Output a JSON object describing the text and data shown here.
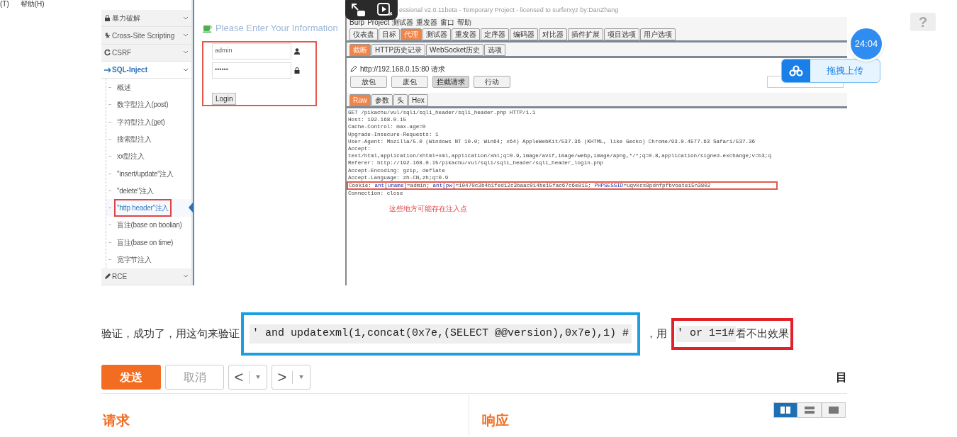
{
  "app_menu": [
    "(T)",
    "帮助(H)"
  ],
  "screenshot": {
    "sidebar": [
      {
        "kind": "group",
        "label": "暴力破解",
        "expanded": false
      },
      {
        "kind": "group",
        "label": "Cross-Site Scripting",
        "expanded": false
      },
      {
        "kind": "group",
        "label": "CSRF",
        "expanded": false
      },
      {
        "kind": "group",
        "label": "SQL-Inject",
        "expanded": true,
        "children": [
          {
            "label": "概述",
            "selected": false,
            "boxed": false
          },
          {
            "label": "数字型注入(post)",
            "selected": false,
            "boxed": false
          },
          {
            "label": "字符型注入(get)",
            "selected": false,
            "boxed": false
          },
          {
            "label": "搜索型注入",
            "selected": false,
            "boxed": false
          },
          {
            "label": "xx型注入",
            "selected": false,
            "boxed": false
          },
          {
            "label": "\"insert/update\"注入",
            "selected": false,
            "boxed": false
          },
          {
            "label": "\"delete\"注入",
            "selected": false,
            "boxed": false
          },
          {
            "label": "\"http header\"注入",
            "selected": true,
            "boxed": true
          },
          {
            "label": "盲注(base on boolian)",
            "selected": false,
            "boxed": false
          },
          {
            "label": "盲注(base on time)",
            "selected": false,
            "boxed": false
          },
          {
            "label": "宽字节注入",
            "selected": false,
            "boxed": false
          }
        ]
      },
      {
        "kind": "group",
        "label": "RCE",
        "expanded": false
      }
    ],
    "login": {
      "title": "Please Enter Your Information",
      "username": "admin",
      "password": "••••••",
      "button": "Login"
    },
    "burp": {
      "title": "essional v2.0.11beta - Temporary Project - licensed to surferxyz by:DanZhang",
      "menu": [
        "Burp",
        "Project",
        "测试器",
        "重发器",
        "窗口",
        "帮助"
      ],
      "tabs": [
        {
          "label": "仪表盘",
          "selected": false
        },
        {
          "label": "目标",
          "selected": false
        },
        {
          "label": "代理",
          "selected": true
        },
        {
          "label": "测试器",
          "selected": false
        },
        {
          "label": "重发器",
          "selected": false
        },
        {
          "label": "定序器",
          "selected": false
        },
        {
          "label": "编码器",
          "selected": false
        },
        {
          "label": "对比器",
          "selected": false
        },
        {
          "label": "插件扩展",
          "selected": false
        },
        {
          "label": "项目选项",
          "selected": false
        },
        {
          "label": "用户选项",
          "selected": false
        }
      ],
      "subtabs": [
        {
          "label": "截断",
          "selected": true
        },
        {
          "label": "HTTP历史记录",
          "selected": false
        },
        {
          "label": "WebSocket历史",
          "selected": false
        },
        {
          "label": "选项",
          "selected": false
        }
      ],
      "url": "http://192.168.0.15:80 请求",
      "buttons": [
        {
          "label": "放包",
          "selected": false
        },
        {
          "label": "废包",
          "selected": false
        },
        {
          "label": "拦截请求",
          "selected": true
        },
        {
          "label": "行动",
          "selected": false
        }
      ],
      "view_tabs": [
        {
          "label": "Raw",
          "selected": true
        },
        {
          "label": "参数",
          "selected": false
        },
        {
          "label": "头",
          "selected": false
        },
        {
          "label": "Hex",
          "selected": false
        }
      ],
      "request_lines": [
        "GET /pikachu/vul/sqli/sqli_header/sqli_header.php HTTP/1.1",
        "Host: 192.168.0.15",
        "Cache-Control: max-age=0",
        "Upgrade-Insecure-Requests: 1",
        "User-Agent: Mozilla/5.0 (Windows NT 10.0; Win64; x64) AppleWebKit/537.36 (KHTML, like Gecko) Chrome/93.0.4577.63 Safari/537.36",
        "Accept:",
        "text/html,application/xhtml+xml,application/xml;q=0.9,image/avif,image/webp,image/apng,*/*;q=0.8,application/signed-exchange;v=b3;q",
        "Referer: http://192.168.0.15/pikachu/vul/sqli/sqli_header/sqli_header_login.php",
        "Accept-Encoding: gzip, deflate",
        "Accept-Language: zh-CN,zh;q=0.9"
      ],
      "cookie": [
        {
          "kind": "text",
          "text": "Cookie: "
        },
        {
          "kind": "key",
          "text": "ant[uname]"
        },
        {
          "kind": "text",
          "text": "=admin; "
        },
        {
          "kind": "key",
          "text": "ant[pw]"
        },
        {
          "kind": "text",
          "text": "=10470c3b4b1fed12c3baac014be15fac67c6e815; "
        },
        {
          "kind": "key",
          "text": "PHPSESSID"
        },
        {
          "kind": "text",
          "text": "=uqvkcs8pdnfpfbvoatei5n3802"
        }
      ],
      "after_cookie": "Connection: close",
      "note": "这些地方可能存在注入点"
    }
  },
  "timer": "24:04",
  "upload": "拖拽上传",
  "help": "?",
  "article": {
    "intro": "验证，成功了，用这句来验证 ",
    "code1": "' and updatexml(1,concat(0x7e,(SELECT @@version),0x7e),1) #",
    "middle": "，用",
    "code2": "' or 1=1#",
    "end": "看不出效果"
  },
  "editor": {
    "buttons": [
      {
        "kind": "primary",
        "label": "发送"
      },
      {
        "kind": "disabled",
        "label": "取消"
      },
      {
        "kind": "nav",
        "label": "<"
      },
      {
        "kind": "nav",
        "label": ">"
      }
    ],
    "right_glyph": "目",
    "panels": [
      {
        "title": "请求"
      },
      {
        "title": "响应"
      }
    ],
    "layouts": [
      {
        "selected": true
      },
      {
        "selected": false
      },
      {
        "selected": false
      }
    ]
  }
}
